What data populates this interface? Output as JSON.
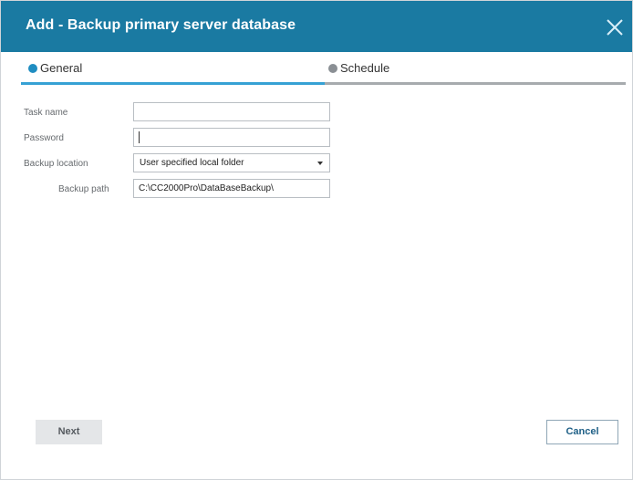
{
  "dialog": {
    "title": "Add - Backup primary server database"
  },
  "tabs": [
    {
      "label": "General",
      "active": true
    },
    {
      "label": "Schedule",
      "active": false
    }
  ],
  "form": {
    "task_name": {
      "label": "Task name",
      "value": ""
    },
    "password": {
      "label": "Password",
      "value": ""
    },
    "backup_location": {
      "label": "Backup location",
      "selected": "User specified local folder"
    },
    "backup_path": {
      "label": "Backup path",
      "value": "C:\\CC2000Pro\\DataBaseBackup\\"
    }
  },
  "buttons": {
    "next": "Next",
    "cancel": "Cancel"
  },
  "colors": {
    "titlebar": "#1a7aa2",
    "active_tab": "#36a1d4",
    "inactive_tab": "#a7abae"
  },
  "icons": {
    "close": "close-icon",
    "general_tab": "status-dot-icon",
    "schedule_tab": "status-dot-icon",
    "dropdown": "dropdown-arrow-icon"
  }
}
